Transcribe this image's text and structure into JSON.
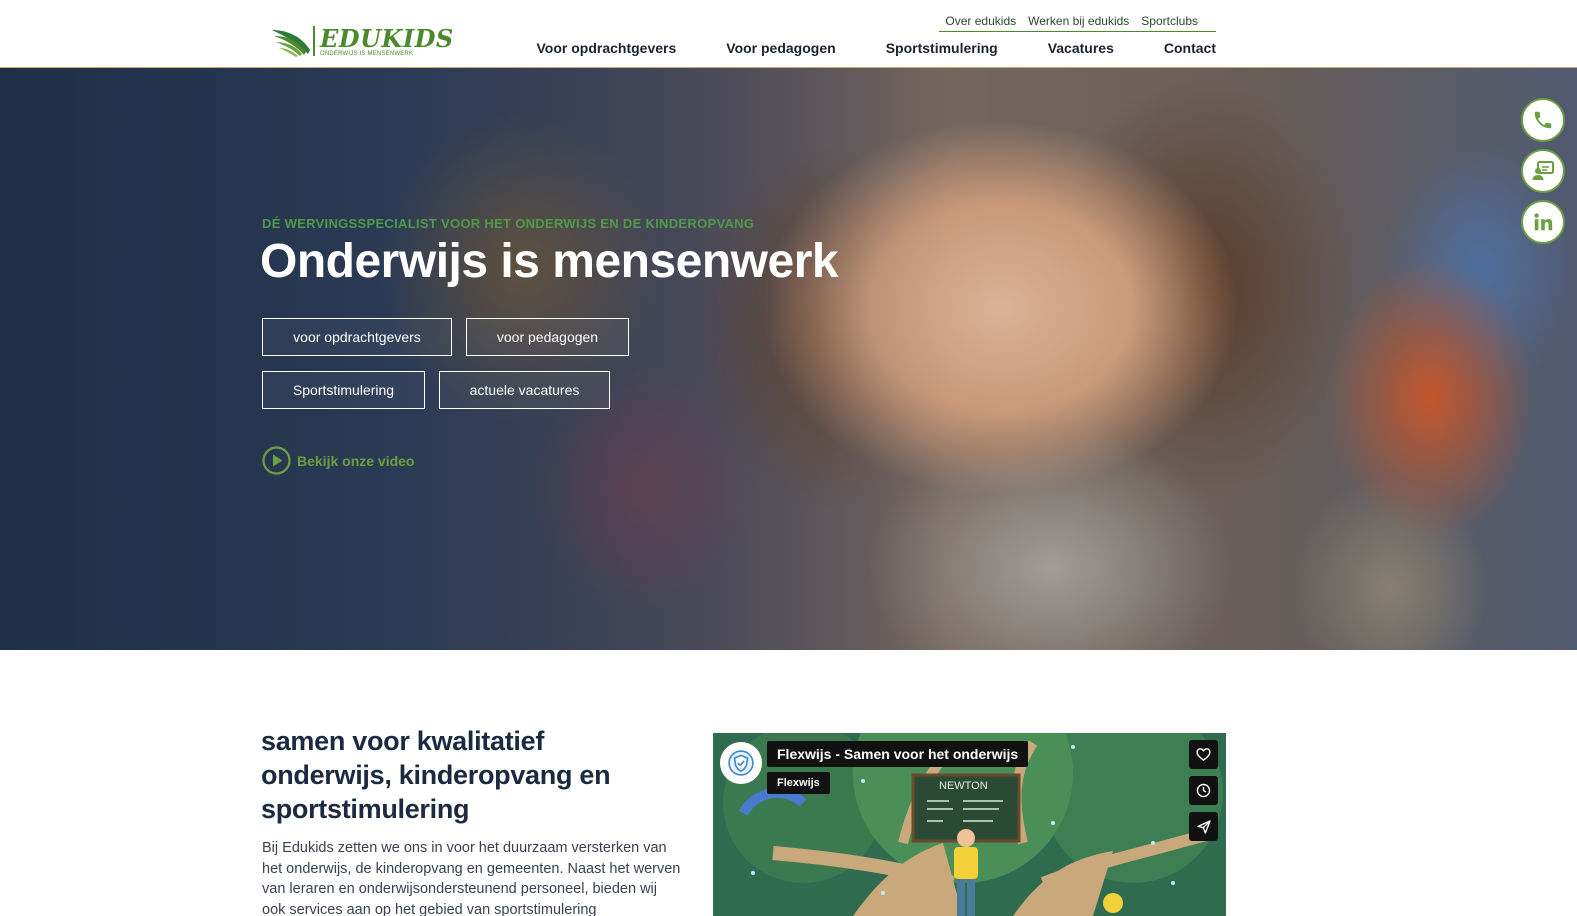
{
  "header": {
    "logo": {
      "brand": "EDUKIDS",
      "tagline": "ONDERWIJS IS MENSENWERK"
    },
    "top_links": [
      "Over edukids",
      "Werken bij edukids",
      "Sportclubs"
    ],
    "main_nav": [
      "Voor opdrachtgevers",
      "Voor pedagogen",
      "Sportstimulering",
      "Vacatures",
      "Contact"
    ]
  },
  "hero": {
    "eyebrow": "DÉ WERVINGSSPECIALIST VOOR HET ONDERWIJS EN DE KINDEROPVANG",
    "headline": "Onderwijs is mensenwerk",
    "buttons": [
      "voor opdrachtgevers",
      "voor pedagogen",
      "Sportstimulering",
      "actuele vacatures"
    ],
    "video_link": "Bekijk onze video"
  },
  "side_buttons": [
    "phone-icon",
    "chat-icon",
    "linkedin-icon"
  ],
  "intro": {
    "title": "samen voor kwalitatief onderwijs, kinderopvang en sportstimulering",
    "body": "Bij Edukids zetten we ons in voor het duurzaam versterken van het onderwijs, de kinderopvang en gemeenten. Naast het werven van leraren en onderwijsondersteunend personeel, bieden wij ook services aan op het gebied van sportstimulering"
  },
  "video": {
    "title": "Flexwijs - Samen voor het onderwijs",
    "channel": "Flexwijs",
    "board_text": "NEWTON"
  },
  "colors": {
    "brand_green": "#4a8a2c",
    "accent_green": "#6aa03f",
    "heading_navy": "#1b2a40"
  }
}
